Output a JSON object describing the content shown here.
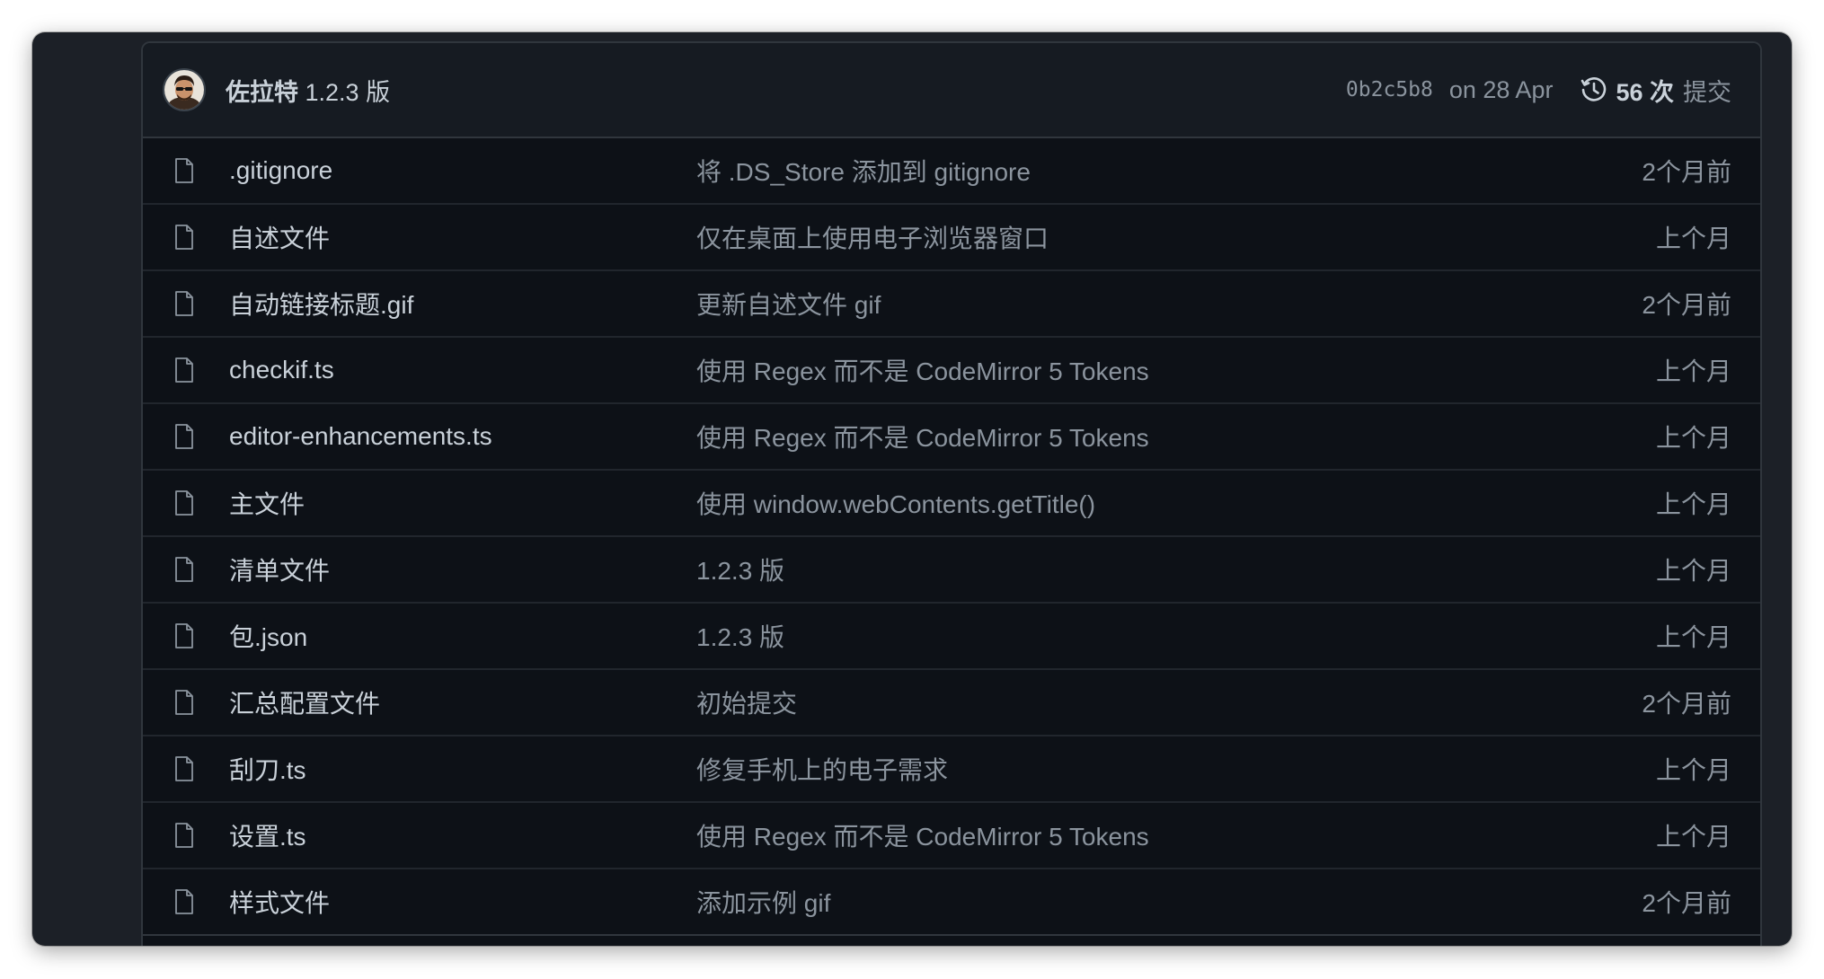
{
  "latest_commit": {
    "author": "佐拉特",
    "message": "1.2.3 版",
    "sha": "0b2c5b8",
    "date": "on 28 Apr",
    "commit_count": "56 次",
    "commit_label": "提交",
    "avatar_icon": "user-avatar"
  },
  "files": [
    {
      "name": ".gitignore",
      "commit": "将 .DS_Store 添加到 gitignore",
      "age": "2个月前",
      "icon": "file-icon"
    },
    {
      "name": "自述文件",
      "commit": "仅在桌面上使用电子浏览器窗口",
      "age": "上个月",
      "icon": "file-icon"
    },
    {
      "name": "自动链接标题.gif",
      "commit": "更新自述文件 gif",
      "age": "2个月前",
      "icon": "file-icon"
    },
    {
      "name": "checkif.ts",
      "commit": "使用 Regex 而不是 CodeMirror 5 Tokens",
      "age": "上个月",
      "icon": "file-icon"
    },
    {
      "name": "editor-enhancements.ts",
      "commit": "使用 Regex 而不是 CodeMirror 5 Tokens",
      "age": "上个月",
      "icon": "file-icon"
    },
    {
      "name": "主文件",
      "commit": "使用 window.webContents.getTitle()",
      "age": "上个月",
      "icon": "file-icon"
    },
    {
      "name": "清单文件",
      "commit": "1.2.3 版",
      "age": "上个月",
      "icon": "file-icon"
    },
    {
      "name": "包.json",
      "commit": "1.2.3 版",
      "age": "上个月",
      "icon": "file-icon"
    },
    {
      "name": "汇总配置文件",
      "commit": "初始提交",
      "age": "2个月前",
      "icon": "file-icon"
    },
    {
      "name": "刮刀.ts",
      "commit": "修复手机上的电子需求",
      "age": "上个月",
      "icon": "file-icon"
    },
    {
      "name": "设置.ts",
      "commit": "使用 Regex 而不是 CodeMirror 5 Tokens",
      "age": "上个月",
      "icon": "file-icon"
    },
    {
      "name": "样式文件",
      "commit": "添加示例 gif",
      "age": "2个月前",
      "icon": "file-icon"
    }
  ],
  "colors": {
    "background": "#0d1117",
    "header": "#161b22",
    "border": "#30363d",
    "text_primary": "#c9d1d9",
    "text_muted": "#8b949e"
  }
}
